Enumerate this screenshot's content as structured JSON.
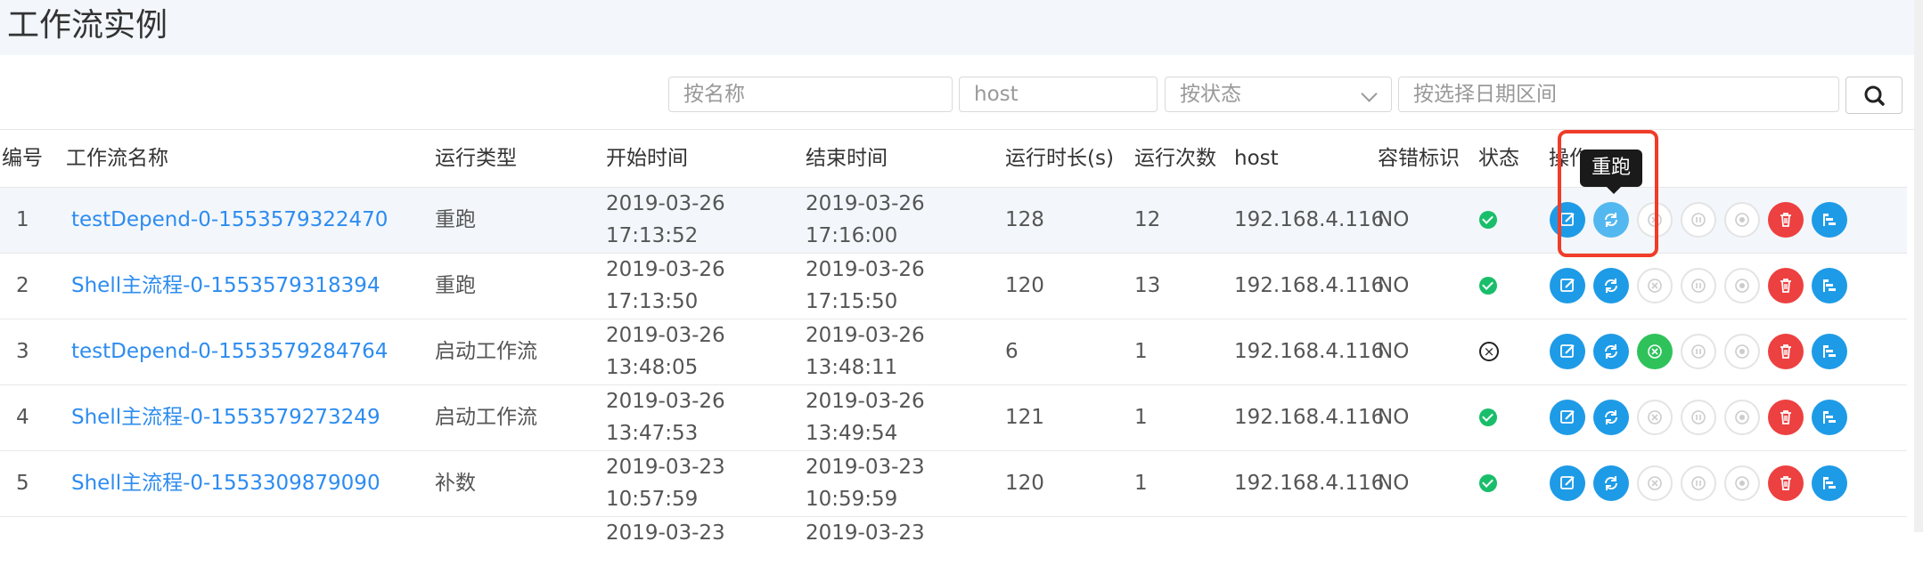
{
  "page": {
    "title": "工作流实例"
  },
  "filters": {
    "name_placeholder": "按名称",
    "host_placeholder": "host",
    "status_placeholder": "按状态",
    "date_placeholder": "按选择日期区间"
  },
  "table": {
    "headers": {
      "no": "编号",
      "name": "工作流名称",
      "run_type": "运行类型",
      "start": "开始时间",
      "end": "结束时间",
      "duration": "运行时长(s)",
      "runs": "运行次数",
      "host": "host",
      "fault": "容错标识",
      "state": "状态",
      "ops": "操作"
    },
    "rows": [
      {
        "no": "1",
        "name": "testDepend-0-1553579322470",
        "run_type": "重跑",
        "start_date": "2019-03-26",
        "start_time": "17:13:52",
        "end_date": "2019-03-26",
        "end_time": "17:16:00",
        "duration": "128",
        "runs": "12",
        "host": "192.168.4.116",
        "fault": "NO",
        "state": "success"
      },
      {
        "no": "2",
        "name": "Shell主流程-0-1553579318394",
        "run_type": "重跑",
        "start_date": "2019-03-26",
        "start_time": "17:13:50",
        "end_date": "2019-03-26",
        "end_time": "17:15:50",
        "duration": "120",
        "runs": "13",
        "host": "192.168.4.116",
        "fault": "NO",
        "state": "success"
      },
      {
        "no": "3",
        "name": "testDepend-0-1553579284764",
        "run_type": "启动工作流",
        "start_date": "2019-03-26",
        "start_time": "13:48:05",
        "end_date": "2019-03-26",
        "end_time": "13:48:11",
        "duration": "6",
        "runs": "1",
        "host": "192.168.4.116",
        "fault": "NO",
        "state": "failed"
      },
      {
        "no": "4",
        "name": "Shell主流程-0-1553579273249",
        "run_type": "启动工作流",
        "start_date": "2019-03-26",
        "start_time": "13:47:53",
        "end_date": "2019-03-26",
        "end_time": "13:49:54",
        "duration": "121",
        "runs": "1",
        "host": "192.168.4.116",
        "fault": "NO",
        "state": "success"
      },
      {
        "no": "5",
        "name": "Shell主流程-0-1553309879090",
        "run_type": "补数",
        "start_date": "2019-03-23",
        "start_time": "10:57:59",
        "end_date": "2019-03-23",
        "end_time": "10:59:59",
        "duration": "120",
        "runs": "1",
        "host": "192.168.4.116",
        "fault": "NO",
        "state": "success"
      },
      {
        "no": "",
        "name": "",
        "run_type": "",
        "start_date": "2019-03-23",
        "start_time": "",
        "end_date": "2019-03-23",
        "end_time": "",
        "duration": "",
        "runs": "",
        "host": "",
        "fault": "",
        "state": ""
      }
    ]
  },
  "tooltip": {
    "text": "重跑"
  },
  "colors": {
    "link": "#2d8cf0",
    "edit": "#1e9be6",
    "rerun_hover": "#54b8f0",
    "recover": "#2fc25b",
    "delete": "#ed4040",
    "success": "#19be6b",
    "highlight": "#f03c28"
  }
}
